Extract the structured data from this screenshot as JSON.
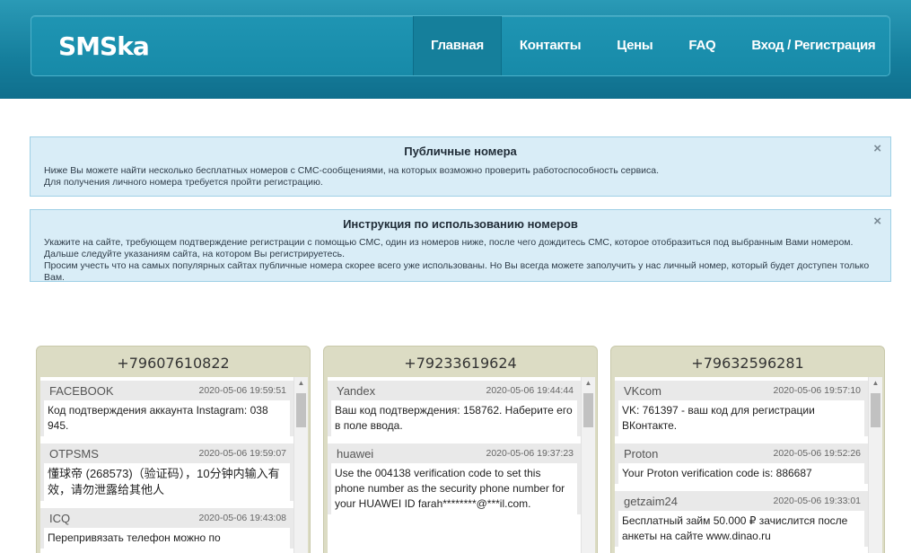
{
  "brand": "SMSka",
  "nav": [
    {
      "label": "Главная",
      "active": true
    },
    {
      "label": "Контакты",
      "active": false
    },
    {
      "label": "Цены",
      "active": false
    },
    {
      "label": "FAQ",
      "active": false
    },
    {
      "label": "Вход / Регистрация",
      "active": false
    }
  ],
  "alerts": [
    {
      "title": "Публичные номера",
      "lines": [
        "Ниже Вы можете найти несколько бесплатных номеров с СМС-сообщениями, на которых возможно проверить работоспособность сервиса.",
        "Для получения личного номера требуется пройти регистрацию."
      ],
      "close": "×"
    },
    {
      "title": "Инструкция по использованию номеров",
      "lines": [
        "Укажите на сайте, требующем подтверждение регистрации с помощью СМС, один из номеров ниже, после чего дождитесь СМС, которое отобразиться под выбранным Вами номером. Дальше следуйте указаниям сайта, на котором Вы регистрируетесь.",
        "Просим учесть что на самых популярных сайтах публичные номера скорее всего уже использованы. Но Вы всегда можете заполучить у нас личный номер, который будет доступен только Вам."
      ],
      "close": "×"
    }
  ],
  "phones": [
    {
      "number": "+79607610822",
      "messages": [
        {
          "sender": "FACEBOOK",
          "time": "2020-05-06 19:59:51",
          "text": "Код подтверждения аккаунта Instagram: 038 945."
        },
        {
          "sender": "OTPSMS",
          "time": "2020-05-06 19:59:07",
          "text": "懂球帝 (268573)（验证码），10分钟内输入有效，请勿泄露给其他人"
        },
        {
          "sender": "ICQ",
          "time": "2020-05-06 19:43:08",
          "text": "Перепривязать телефон можно по"
        }
      ]
    },
    {
      "number": "+79233619624",
      "messages": [
        {
          "sender": "Yandex",
          "time": "2020-05-06 19:44:44",
          "text": "Ваш код подтверждения: 158762. Наберите его в поле ввода."
        },
        {
          "sender": "huawei",
          "time": "2020-05-06 19:37:23",
          "text": "Use the 004138 verification code to set this phone number as the security phone number for your HUAWEI ID farah********@***il.com."
        }
      ]
    },
    {
      "number": "+79632596281",
      "messages": [
        {
          "sender": "VKcom",
          "time": "2020-05-06 19:57:10",
          "text": "VK: 761397 - ваш код для регистрации ВКонтакте."
        },
        {
          "sender": "Proton",
          "time": "2020-05-06 19:52:26",
          "text": "Your Proton verification code is: 886687"
        },
        {
          "sender": "getzaim24",
          "time": "2020-05-06 19:33:01",
          "text": "Бесплатный займ 50.000 ₽ зачислится после анкеты на сайте www.dinao.ru"
        }
      ]
    }
  ],
  "scroll_icons": {
    "up": "▲",
    "down": "▼"
  }
}
